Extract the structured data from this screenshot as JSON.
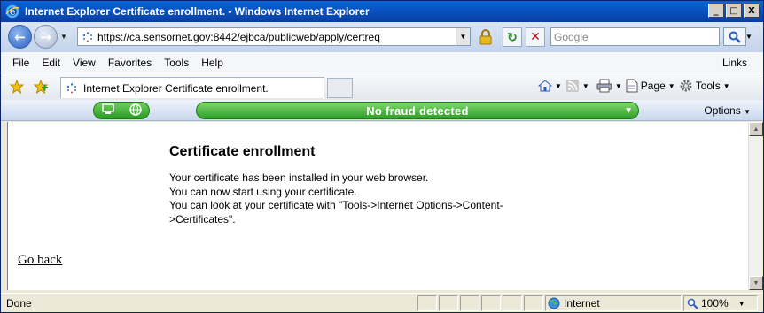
{
  "window": {
    "title": "Internet Explorer Certificate enrollment. - Windows Internet Explorer",
    "minimize": "_",
    "maximize": "□",
    "close": "X"
  },
  "address": {
    "url": "https://ca.sensornet.gov:8442/ejbca/publicweb/apply/certreq",
    "search_placeholder": "Google"
  },
  "menu": {
    "items": [
      "File",
      "Edit",
      "View",
      "Favorites",
      "Tools",
      "Help"
    ],
    "links": "Links"
  },
  "tab": {
    "label": "Internet Explorer Certificate enrollment."
  },
  "commandbar": {
    "page": "Page",
    "tools": "Tools"
  },
  "phishing": {
    "status": "No fraud detected",
    "options": "Options"
  },
  "page": {
    "heading": "Certificate enrollment",
    "lines": [
      "Your certificate has been installed in your web browser.",
      "You can now start using your certificate.",
      "You can look at your certificate with \"Tools->Internet Options->Content->Certificates\"."
    ],
    "go_back": "Go back"
  },
  "status": {
    "text": "Done",
    "zone": "Internet",
    "zoom": "100%"
  },
  "colors": {
    "title_bar": "#0a3ea4",
    "fraud_ok": "#2f9e2a"
  }
}
